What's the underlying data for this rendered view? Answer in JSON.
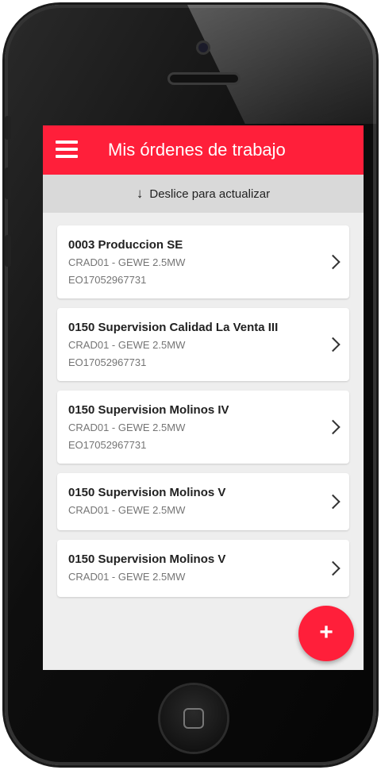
{
  "app": {
    "title": "Mis órdenes de trabajo",
    "accent_color": "#ff1f3a",
    "menu_icon": "hamburger-menu-icon"
  },
  "refresh": {
    "arrow": "↓",
    "label": "Deslice para actualizar"
  },
  "orders": [
    {
      "title": "0003 Produccion SE",
      "line1": "CRAD01 - GEWE 2.5MW",
      "line2": "EO17052967731"
    },
    {
      "title": "0150 Supervision Calidad La Venta III",
      "line1": "CRAD01 - GEWE 2.5MW",
      "line2": "EO17052967731"
    },
    {
      "title": "0150 Supervision Molinos IV",
      "line1": "CRAD01 - GEWE 2.5MW",
      "line2": "EO17052967731"
    },
    {
      "title": "0150 Supervision Molinos V",
      "line1": "CRAD01 - GEWE 2.5MW"
    },
    {
      "title": "0150 Supervision Molinos V",
      "line1": "CRAD01 - GEWE 2.5MW"
    }
  ],
  "fab": {
    "label": "+",
    "icon": "plus-icon"
  }
}
